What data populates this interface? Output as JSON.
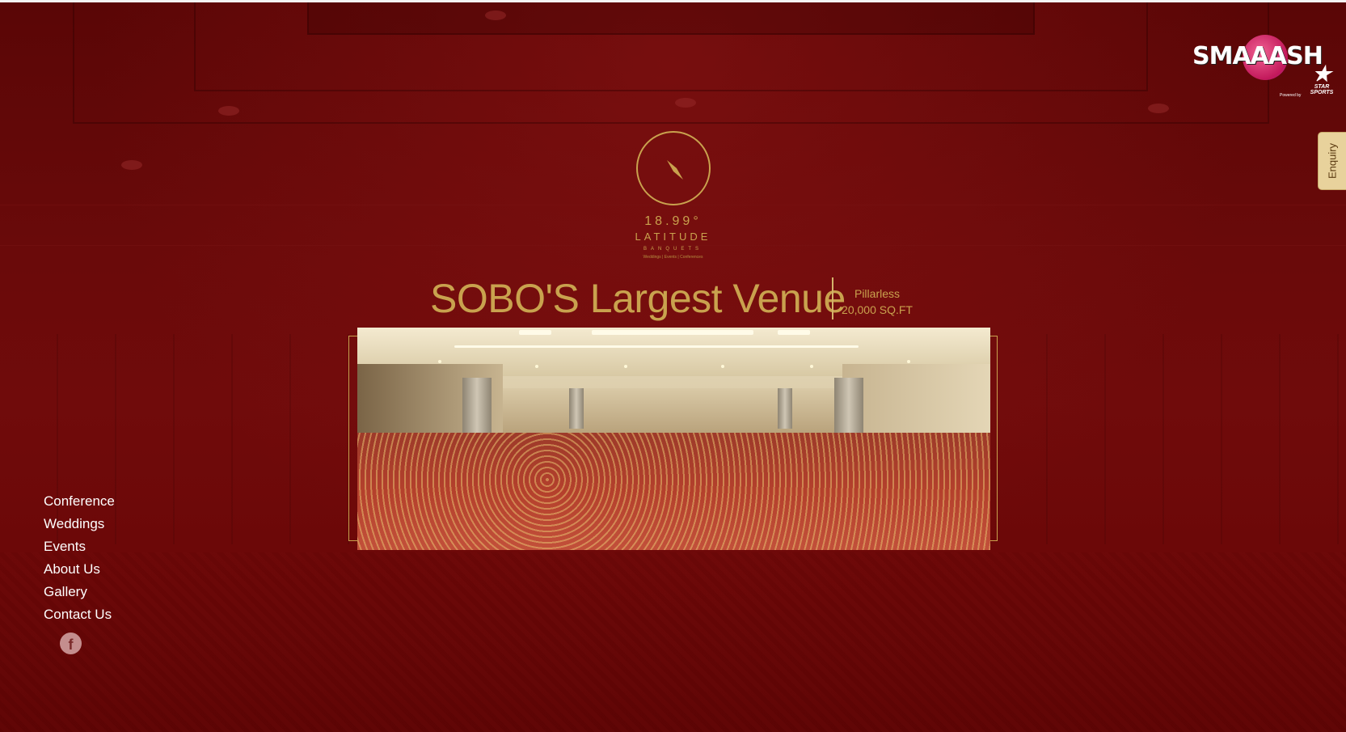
{
  "top_logo": {
    "word": "SMAAASH",
    "powered_by": "Powered by",
    "partner": "STAR SPORTS"
  },
  "enquiry": {
    "label": "Enquiry"
  },
  "brand": {
    "number": "18.99°",
    "name": "LATITUDE",
    "sub": "BANQUETS",
    "tagline": "Weddings | Events | Conferences"
  },
  "hero": {
    "headline": "SOBO'S Largest Venue",
    "side_line1": "Pillarless",
    "side_line2": "20,000 SQ.FT"
  },
  "nav": {
    "items": [
      {
        "label": "Conference"
      },
      {
        "label": "Weddings"
      },
      {
        "label": "Events"
      },
      {
        "label": "About Us"
      },
      {
        "label": "Gallery"
      },
      {
        "label": "Contact Us"
      }
    ]
  },
  "social": {
    "facebook_glyph": "f"
  },
  "colors": {
    "background": "#6a0a0a",
    "gold": "#c9a24e",
    "enquiry_tab": "#e8d29c"
  }
}
